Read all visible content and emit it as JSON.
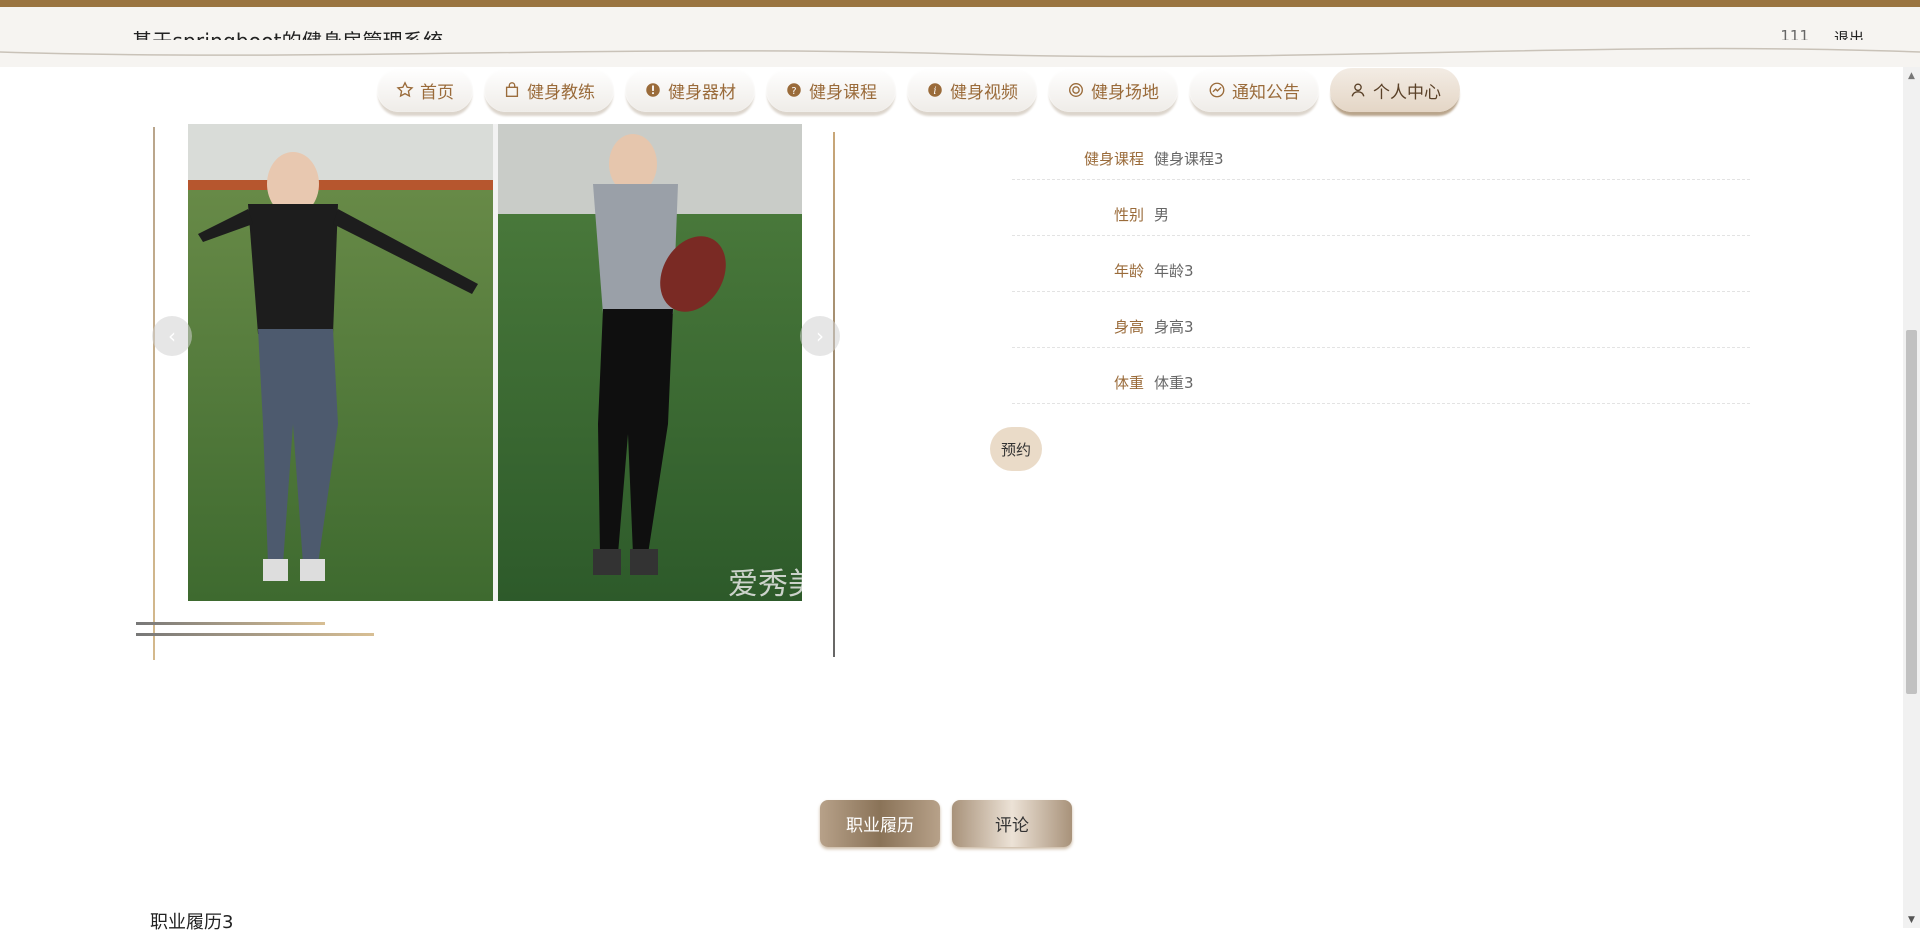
{
  "header": {
    "title": "基于springboot的健身房管理系统",
    "user": "111",
    "logout": "退出"
  },
  "nav": [
    {
      "label": "首页",
      "icon": "star-icon"
    },
    {
      "label": "健身教练",
      "icon": "bag-icon"
    },
    {
      "label": "健身器材",
      "icon": "exclamation-icon"
    },
    {
      "label": "健身课程",
      "icon": "question-icon"
    },
    {
      "label": "健身视频",
      "icon": "info-icon"
    },
    {
      "label": "健身场地",
      "icon": "target-icon"
    },
    {
      "label": "通知公告",
      "icon": "trend-icon"
    },
    {
      "label": "个人中心",
      "icon": "user-icon",
      "active": true
    }
  ],
  "carousel": {
    "prev": "‹",
    "next": "›",
    "watermark": "爱秀美"
  },
  "details": [
    {
      "label": "健身课程",
      "value": "健身课程3"
    },
    {
      "label": "性别",
      "value": "男"
    },
    {
      "label": "年龄",
      "value": "年龄3"
    },
    {
      "label": "身高",
      "value": "身高3"
    },
    {
      "label": "体重",
      "value": "体重3"
    }
  ],
  "book_button": "预约",
  "tabs": {
    "resume": "职业履历",
    "comment": "评论"
  },
  "content": "职业履历3",
  "colors": {
    "accent": "#9a6b3a",
    "stripe": "#9a7440"
  }
}
